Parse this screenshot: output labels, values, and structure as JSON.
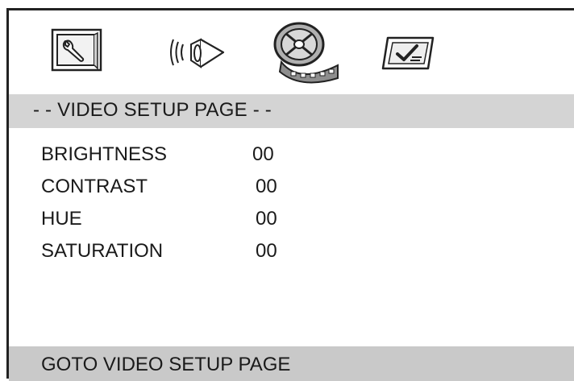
{
  "toolbar": {
    "icons": [
      {
        "name": "general-setup-icon"
      },
      {
        "name": "audio-setup-icon"
      },
      {
        "name": "video-setup-icon",
        "selected": true
      },
      {
        "name": "preference-setup-icon"
      }
    ]
  },
  "page": {
    "title": "- - VIDEO SETUP PAGE - -"
  },
  "settings": [
    {
      "label": "BRIGHTNESS",
      "value": "00"
    },
    {
      "label": "CONTRAST",
      "value": "00"
    },
    {
      "label": "HUE",
      "value": "00"
    },
    {
      "label": "SATURATION",
      "value": "00"
    }
  ],
  "status": {
    "text": "GOTO VIDEO SETUP PAGE"
  },
  "colors": {
    "background": "#ffffff",
    "title_bar": "#d4d4d4",
    "status_bar": "#c9c9c9",
    "text": "#1a1a1a"
  }
}
